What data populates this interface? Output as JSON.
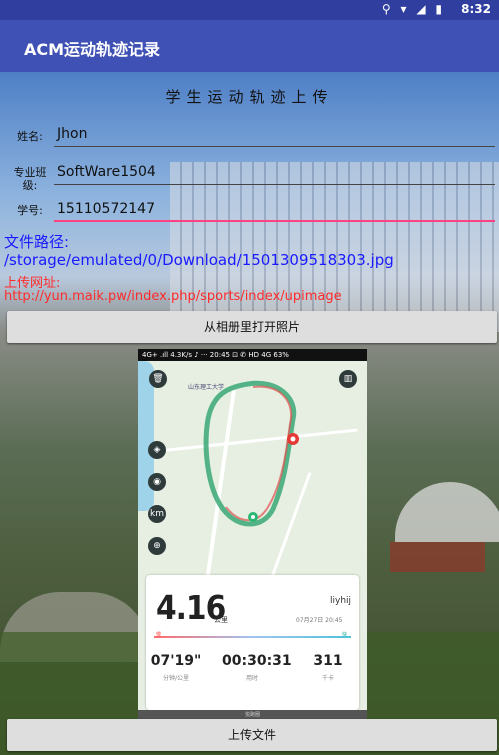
{
  "status_bar": {
    "time": "8:32",
    "icons": "⚲ ▾ ◢ ▮"
  },
  "app_bar": {
    "title": "ACM运动轨迹记录"
  },
  "form": {
    "heading": "学生运动轨迹上传",
    "name_label": "姓名:",
    "name_value": "Jhon",
    "class_label": "专业班级:",
    "class_value": "SoftWare1504",
    "id_label": "学号:",
    "id_value": "15110572147"
  },
  "file": {
    "path_label": "文件路径:",
    "path_value": "/storage/emulated/0/Download/1501309518303.jpg",
    "url_label": "上传网址:",
    "url_value": "http://yun.maik.pw/index.php/sports/index/upimage"
  },
  "buttons": {
    "open_album": "从相册里打开照片",
    "upload": "上传文件"
  },
  "preview": {
    "status": "4G+ .ıll  4.3K/s  ♪  ···   20:45       ⊡ ✆ HD 4G  63%",
    "map_label": "山东理工大学",
    "distance": "4.16",
    "distance_unit": "公里",
    "username": "liyhij",
    "date": "07月27日 20:45",
    "slow": "慢",
    "fast": "快",
    "pace_value": "07'19\"",
    "pace_label": "分钟/公里",
    "time_value": "00:30:31",
    "time_label": "用时",
    "cal_value": "311",
    "cal_label": "千卡",
    "footer": "悦跑圈"
  }
}
